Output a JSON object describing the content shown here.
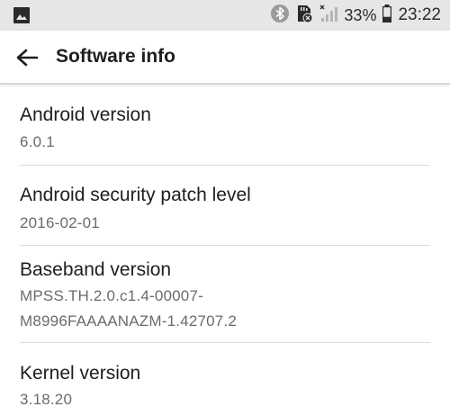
{
  "status_bar": {
    "battery_percent": "33%",
    "time": "23:22",
    "icons": [
      "image-icon",
      "bluetooth-icon",
      "sd-card-icon",
      "signal-icon",
      "battery-icon"
    ]
  },
  "app_bar": {
    "title": "Software info",
    "back_icon": "arrow-back-icon"
  },
  "items": [
    {
      "title": "Android version",
      "value": "6.0.1"
    },
    {
      "title": "Android security patch level",
      "value": "2016-02-01"
    },
    {
      "title": "Baseband version",
      "value": "MPSS.TH.2.0.c1.4-00007-",
      "value_line2": "M8996FAAAANAZM-1.42707.2"
    },
    {
      "title": "Kernel version",
      "value": "3.18.20"
    }
  ],
  "colors": {
    "status_bar_bg": "#e6e6e6",
    "title_text": "#1e1e1e",
    "secondary_text": "#6b6b6b",
    "divider": "#dcdcdc"
  }
}
